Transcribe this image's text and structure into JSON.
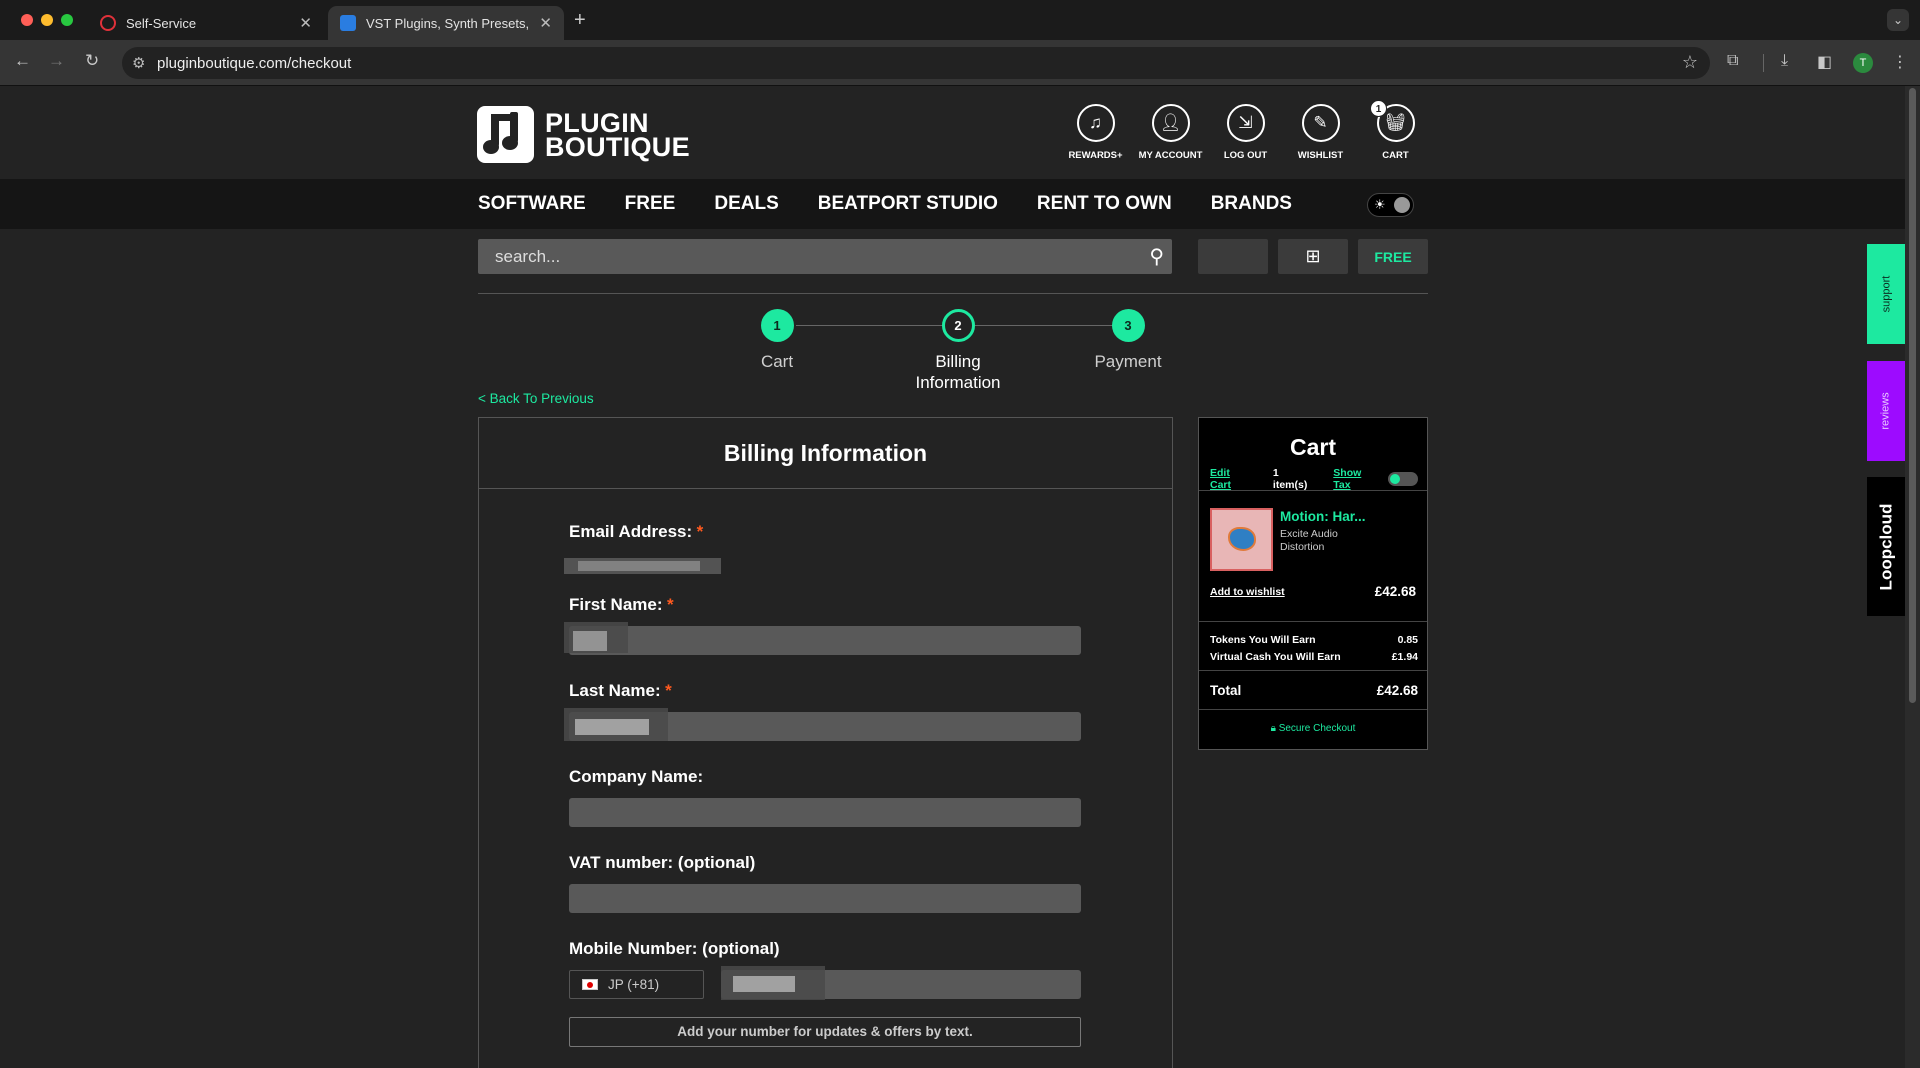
{
  "browser": {
    "tabs": [
      {
        "title": "Self-Service",
        "active": false
      },
      {
        "title": "VST Plugins, Synth Presets, E",
        "active": true
      }
    ],
    "url": "pluginboutique.com/checkout",
    "profile_initial": "T",
    "new_tab_label": "+"
  },
  "site": {
    "logo": {
      "line1": "PLUGIN",
      "line2": "BOUTIQUE"
    },
    "header_icons": [
      {
        "label": "REWARDS+",
        "icon": "music-note-plus-icon"
      },
      {
        "label": "MY ACCOUNT",
        "icon": "user-icon"
      },
      {
        "label": "LOG OUT",
        "icon": "logout-icon"
      },
      {
        "label": "WISHLIST",
        "icon": "wand-icon"
      },
      {
        "label": "CART",
        "icon": "basket-icon",
        "badge": "1"
      }
    ],
    "nav": [
      "SOFTWARE",
      "FREE",
      "DEALS",
      "BEATPORT STUDIO",
      "RENT TO OWN",
      "BRANDS"
    ],
    "search": {
      "placeholder": "search..."
    },
    "filters": {
      "free_label": "FREE"
    }
  },
  "checkout": {
    "steps": [
      {
        "num": "1",
        "label": "Cart",
        "state": "done"
      },
      {
        "num": "2",
        "label": "Billing Information",
        "state": "active"
      },
      {
        "num": "3",
        "label": "Payment",
        "state": "done"
      }
    ],
    "back_link": "< Back To Previous",
    "form": {
      "title": "Billing Information",
      "email_label": "Email Address:",
      "first_name_label": "First Name:",
      "last_name_label": "Last Name:",
      "company_label": "Company Name:",
      "vat_label": "VAT number: (optional)",
      "mobile_label": "Mobile Number: (optional)",
      "required_mark": "*",
      "country_code": "JP (+81)",
      "sms_note": "Add your number for updates & offers by text."
    }
  },
  "cart": {
    "title": "Cart",
    "edit_cart": "Edit Cart",
    "item_count": "1 item(s)",
    "show_tax": "Show Tax",
    "product": {
      "name": "Motion: Har...",
      "vendor_line1": "Excite Audio",
      "vendor_line2": "Distortion",
      "price": "£42.68"
    },
    "add_to_wishlist": "Add to wishlist",
    "tokens_label": "Tokens You Will Earn",
    "tokens_value": "0.85",
    "cash_label": "Virtual Cash You Will Earn",
    "cash_value": "£1.94",
    "total_label": "Total",
    "total_value": "£42.68",
    "secure_label": "Secure Checkout"
  },
  "side_tabs": {
    "support": "support",
    "reviews": "reviews",
    "loopcloud": "Loopcloud"
  },
  "colors": {
    "accent": "#1de9a0",
    "reviews": "#9d0bff",
    "required": "#ff5a1f"
  }
}
